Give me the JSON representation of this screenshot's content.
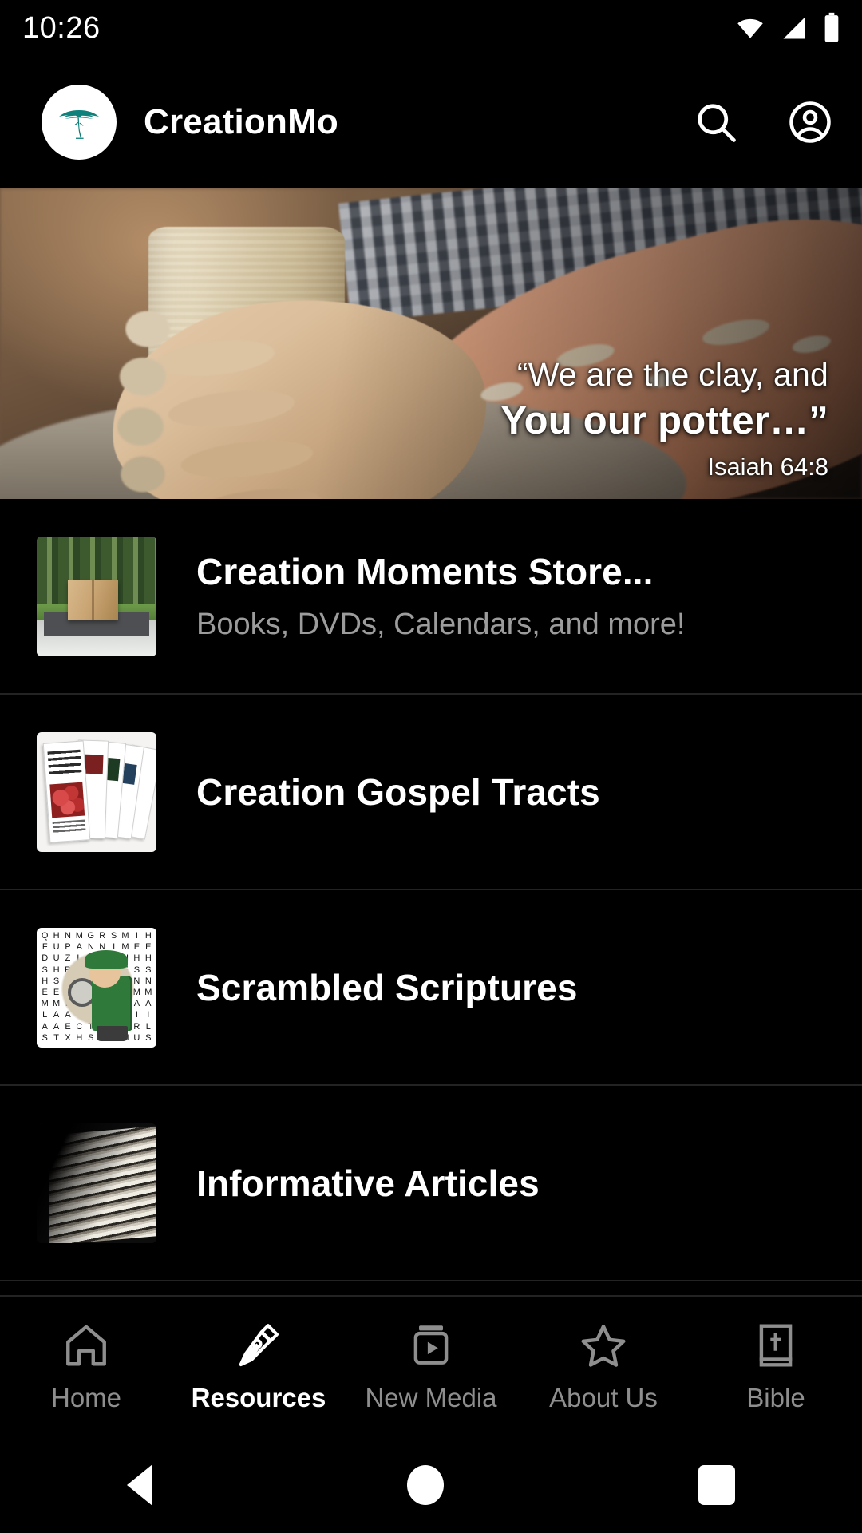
{
  "status_bar": {
    "time": "10:26",
    "icons": [
      "wifi-icon",
      "cellular-signal-icon",
      "battery-icon"
    ]
  },
  "app_bar": {
    "logo_icon": "acacia-tree-logo",
    "logo_color": "#0f7f77",
    "title": "CreationMo",
    "search_icon": "search-icon",
    "account_icon": "account-circle-icon"
  },
  "hero": {
    "image_description": "potter-hands-shaping-clay",
    "quote_line1": "“We are the clay, and",
    "quote_line2": "You our potter…”",
    "reference": "Isaiah 64:8"
  },
  "list": {
    "items": [
      {
        "title": "Creation Moments Store...",
        "subtitle": "Books, DVDs, Calendars, and more!",
        "thumb": "parcel-on-doormat-thumb"
      },
      {
        "title": "Creation Gospel Tracts",
        "subtitle": "",
        "thumb": "gospel-tracts-fan-thumb"
      },
      {
        "title": "Scrambled Scriptures",
        "subtitle": "",
        "thumb": "word-search-detective-thumb"
      },
      {
        "title": "Informative Articles",
        "subtitle": "",
        "thumb": "stacked-newspapers-thumb"
      }
    ]
  },
  "word_search_letters": [
    "Q",
    "H",
    "N",
    "M",
    "G",
    "R",
    "S",
    "M",
    "I",
    "H",
    "F",
    "U",
    "P",
    "A",
    "N",
    "N",
    "I",
    "M",
    "E",
    "E",
    "D",
    "U",
    "Z",
    "L",
    "U",
    "N",
    "H",
    "H",
    "H",
    "H",
    "S",
    "H",
    "R",
    "E",
    "D",
    "S",
    "L",
    "E",
    "S",
    "S",
    "H",
    "S",
    "O",
    "R",
    "O",
    "R",
    "M",
    "I",
    "N",
    "N",
    "E",
    "E",
    "L",
    "I",
    "N",
    "G",
    "E",
    "T",
    "M",
    "M",
    "M",
    "M",
    "L",
    "S",
    "E",
    "S",
    "S",
    "E",
    "A",
    "A",
    "L",
    "A",
    "A",
    "E",
    "Y",
    "R",
    "T",
    "R",
    "I",
    "I",
    "A",
    "A",
    "E",
    "C",
    "T",
    "O",
    "H",
    "H",
    "R",
    "L",
    "S",
    "T",
    "X",
    "H",
    "S",
    "H",
    "S",
    "M",
    "U",
    "S"
  ],
  "bottom_nav": {
    "items": [
      {
        "label": "Home",
        "icon": "home-icon",
        "active": false
      },
      {
        "label": "Resources",
        "icon": "pen-nib-icon",
        "active": true
      },
      {
        "label": "New Media",
        "icon": "video-player-icon",
        "active": false
      },
      {
        "label": "About Us",
        "icon": "star-icon",
        "active": false
      },
      {
        "label": "Bible",
        "icon": "bible-book-icon",
        "active": false
      }
    ]
  },
  "android_nav": {
    "back": "back-triangle-icon",
    "home": "home-circle-icon",
    "recents": "recents-square-icon"
  },
  "colors": {
    "background": "#000000",
    "primary_text": "#ffffff",
    "secondary_text": "#9c9c9c",
    "divider": "#232323",
    "brand": "#0f7f77"
  }
}
